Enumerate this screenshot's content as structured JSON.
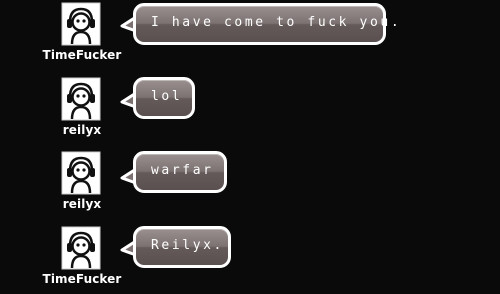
{
  "messages": [
    {
      "username": "TimeFucker",
      "text": "I have come to fuck you.",
      "avatar_icon": "headphone-person-icon"
    },
    {
      "username": "reilyx",
      "text": "lol",
      "avatar_icon": "headphone-person-icon"
    },
    {
      "username": "reilyx",
      "text": "warfar",
      "avatar_icon": "headphone-person-icon"
    },
    {
      "username": "TimeFucker",
      "text": "Reilyx.",
      "avatar_icon": "headphone-person-icon"
    }
  ],
  "colors": {
    "background": "#0a0a0a",
    "bubble_border": "#ffffff",
    "bubble_fill_top": "#9a9090",
    "bubble_fill_bottom": "#5a5050",
    "text": "#ffffff"
  }
}
